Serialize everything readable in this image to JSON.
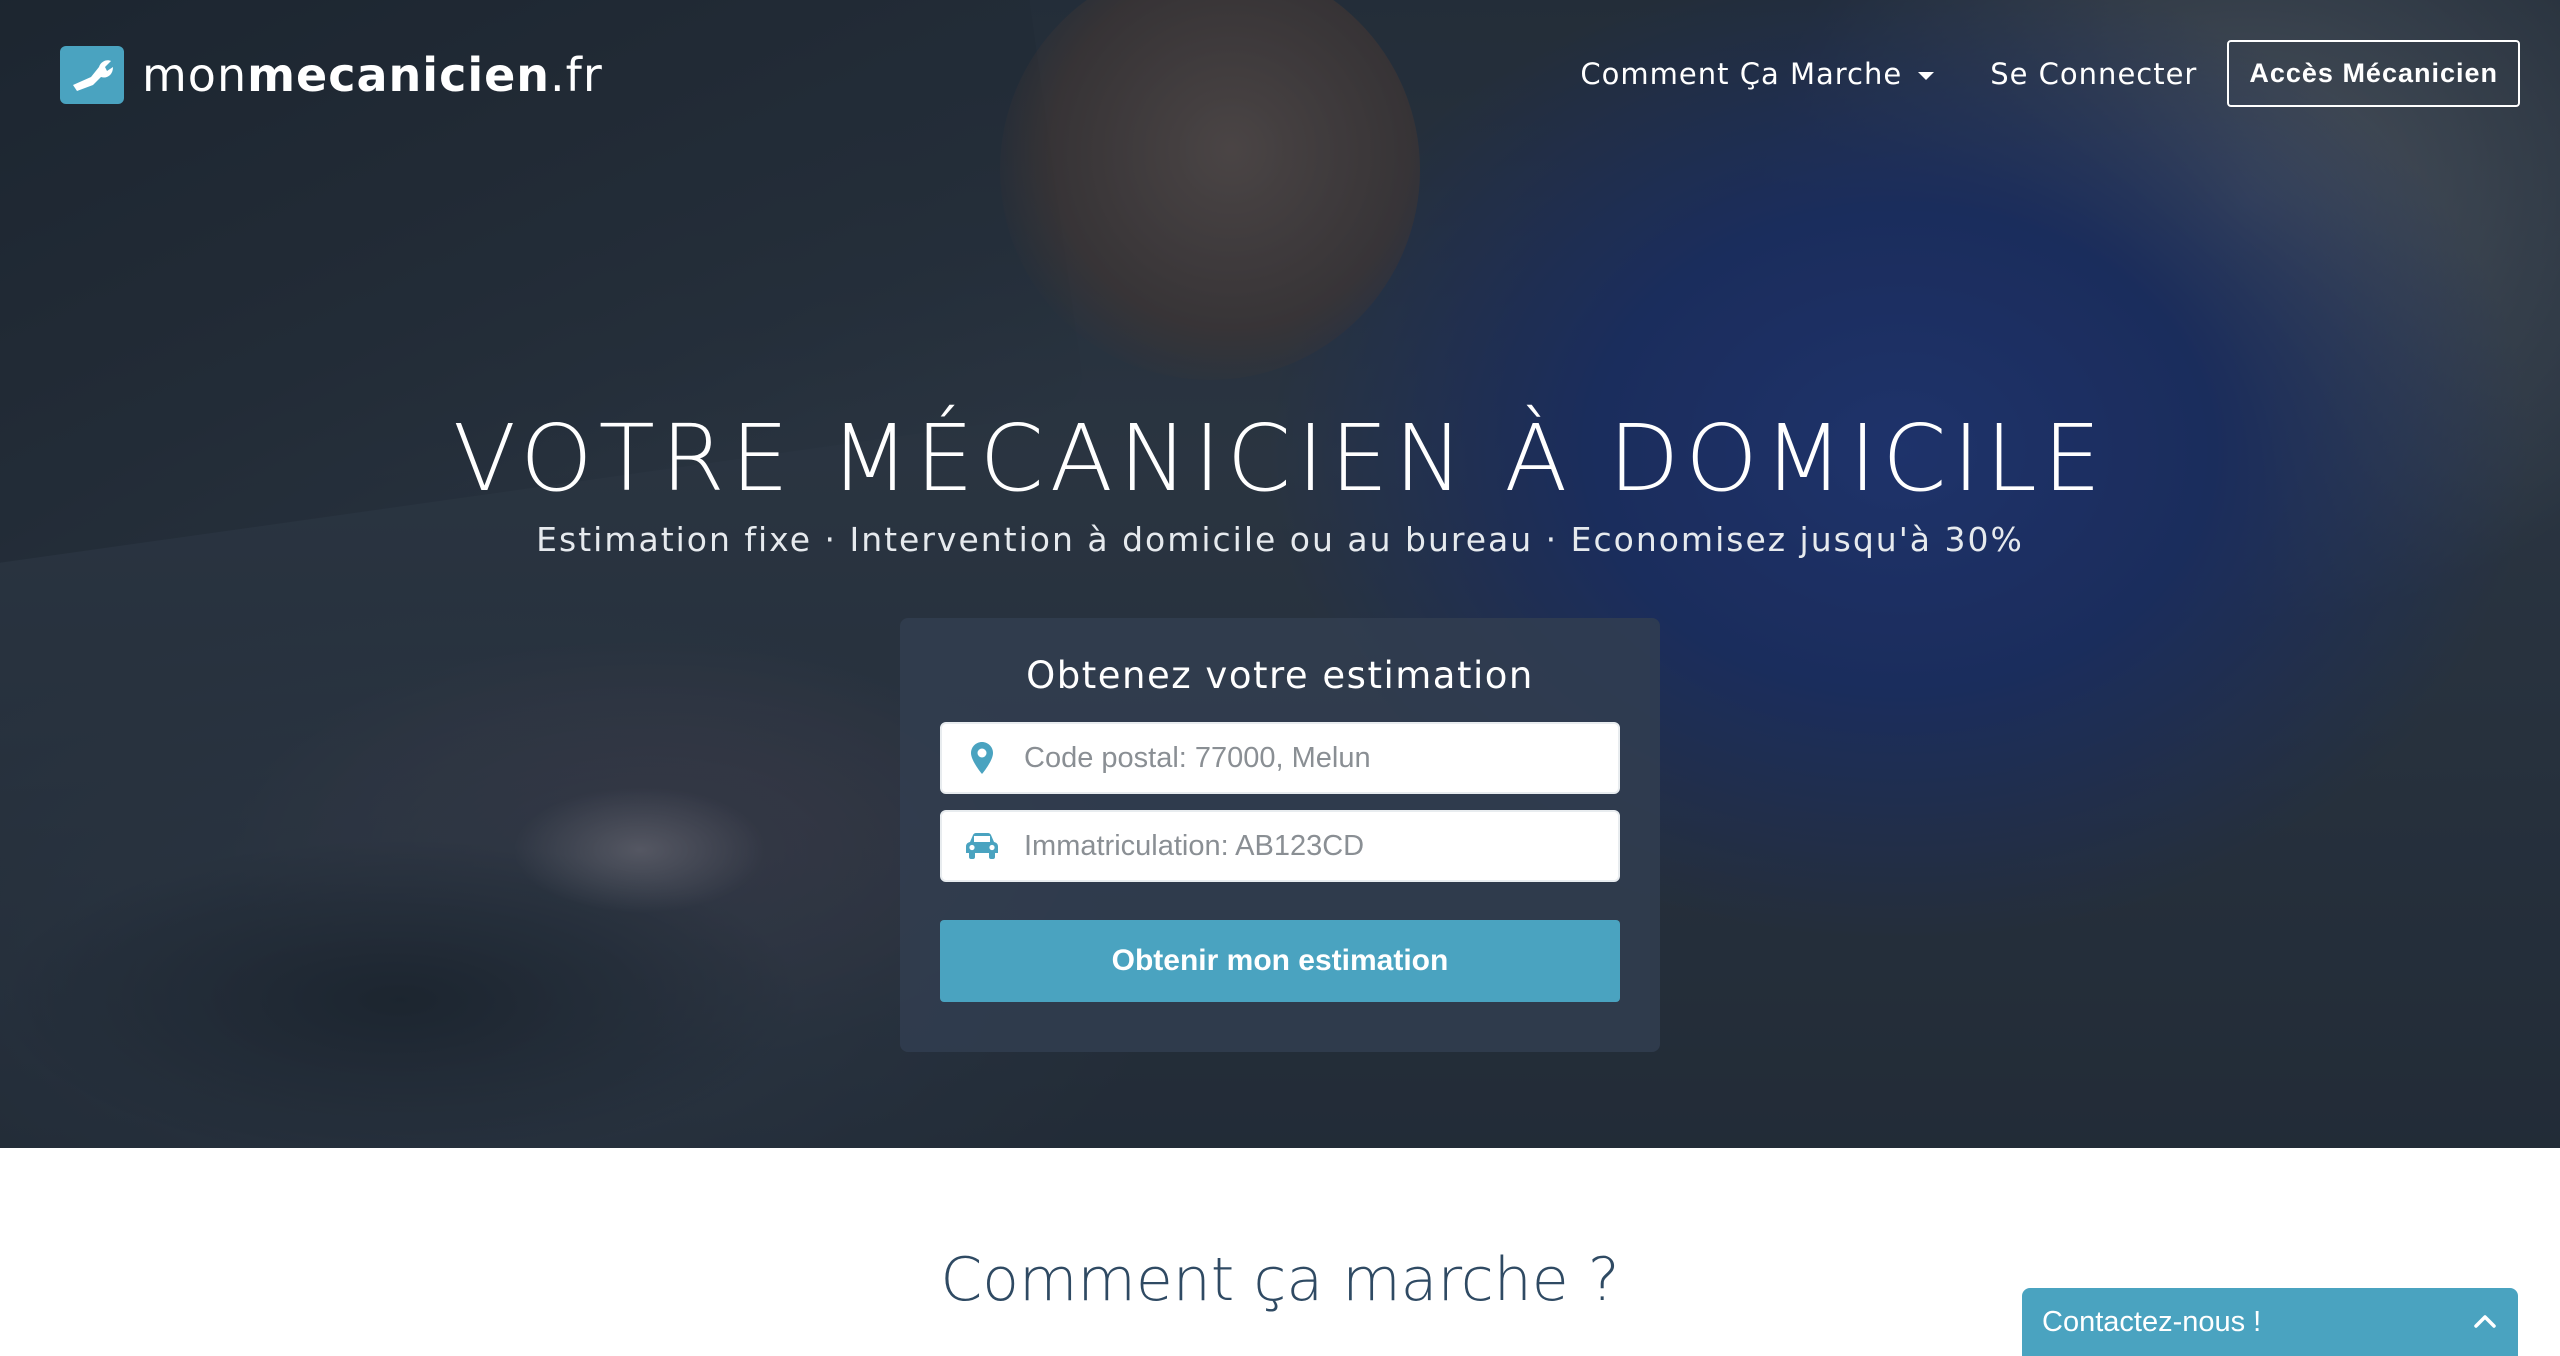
{
  "brand": {
    "name_light": "mon",
    "name_bold": "mecanicien",
    "name_suffix": ".fr",
    "accent_color": "#4aa3c0",
    "logo_icon": "wrench-icon"
  },
  "nav": {
    "how_it_works": "Comment Ça Marche",
    "login": "Se Connecter",
    "mechanic_access": "Accès Mécanicien"
  },
  "hero": {
    "title": "VOTRE MÉCANICIEN À DOMICILE",
    "subtitle": "Estimation fixe · Intervention à domicile ou au bureau · Economisez jusqu'à 30%"
  },
  "estimate_form": {
    "title": "Obtenez votre estimation",
    "postal_placeholder": "Code postal: 77000, Melun",
    "plate_placeholder": "Immatriculation: AB123CD",
    "submit_label": "Obtenir mon estimation",
    "postal_icon": "map-pin-icon",
    "plate_icon": "car-icon"
  },
  "section": {
    "how_title": "Comment ça marche ?"
  },
  "contact_widget": {
    "label": "Contactez-nous !",
    "icon": "chevron-up-icon"
  }
}
